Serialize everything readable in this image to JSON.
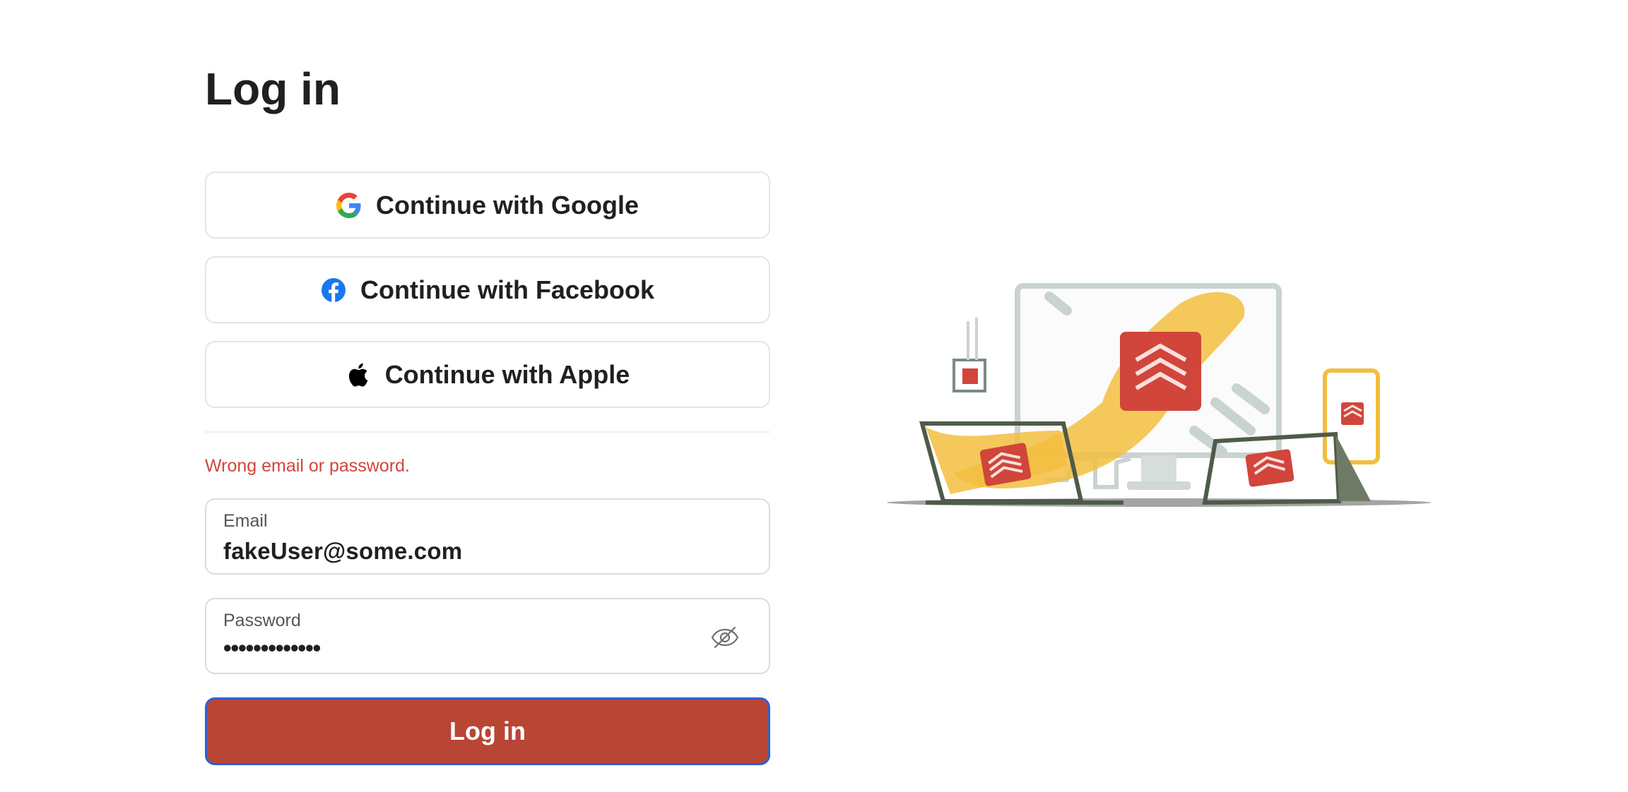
{
  "page": {
    "title": "Log in"
  },
  "social": {
    "google_label": "Continue with Google",
    "facebook_label": "Continue with Facebook",
    "apple_label": "Continue with Apple",
    "google_icon": "google-icon",
    "facebook_icon": "facebook-icon",
    "apple_icon": "apple-icon"
  },
  "error": {
    "message": "Wrong email or password."
  },
  "email": {
    "label": "Email",
    "value": "fakeUser@some.com"
  },
  "password": {
    "label": "Password",
    "masked_value": "•••••••••••••",
    "toggle_icon": "eye-slash-icon"
  },
  "actions": {
    "login_label": "Log in"
  },
  "colors": {
    "accent": "#b94535",
    "error": "#d1453b",
    "focus_ring": "#2f5fd0"
  }
}
